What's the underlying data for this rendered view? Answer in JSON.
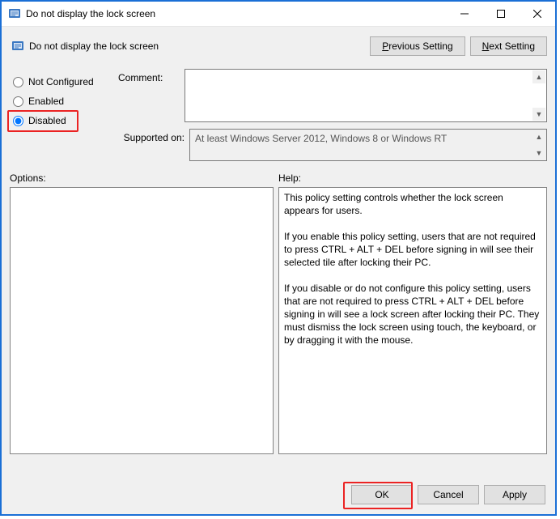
{
  "window": {
    "title": "Do not display the lock screen"
  },
  "header": {
    "title": "Do not display the lock screen"
  },
  "nav": {
    "previous_prefix": "P",
    "previous_rest": "revious Setting",
    "next_prefix": "N",
    "next_rest": "ext Setting"
  },
  "state": {
    "not_configured": "Not Configured",
    "enabled": "Enabled",
    "disabled": "Disabled",
    "selected": "disabled"
  },
  "labels": {
    "comment": "Comment:",
    "supported_on": "Supported on:",
    "options": "Options:",
    "help": "Help:"
  },
  "comment_value": "",
  "supported_on_value": "At least Windows Server 2012, Windows 8 or Windows RT",
  "options_content": "",
  "help_content": {
    "p1": "This policy setting controls whether the lock screen appears for users.",
    "p2": "If you enable this policy setting, users that are not required to press CTRL + ALT + DEL before signing in will see their selected tile after locking their PC.",
    "p3": "If you disable or do not configure this policy setting, users that are not required to press CTRL + ALT + DEL before signing in will see a lock screen after locking their PC. They must dismiss the lock screen using touch, the keyboard, or by dragging it with the mouse."
  },
  "footer": {
    "ok": "OK",
    "cancel": "Cancel",
    "apply": "Apply"
  }
}
